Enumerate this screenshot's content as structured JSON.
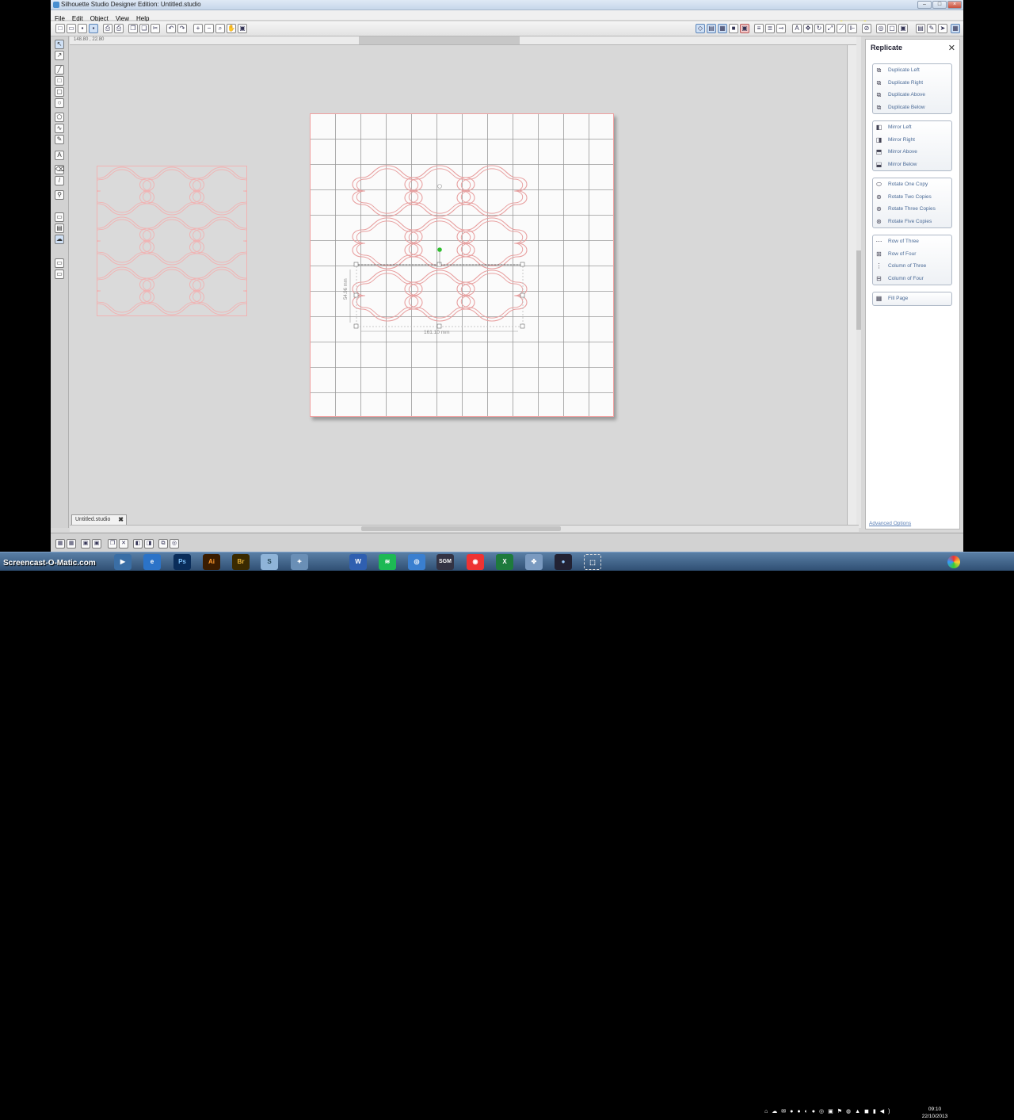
{
  "window": {
    "title": "Silhouette Studio Designer Edition: Untitled.studio"
  },
  "menu": [
    "File",
    "Edit",
    "Object",
    "View",
    "Help"
  ],
  "ruler": {
    "top_readout": "148.80 , 22.80"
  },
  "document_tab": {
    "label": "Untitled.studio"
  },
  "selection": {
    "width_label": "161.10 mm",
    "height_label": "54.96 mm"
  },
  "replicate_panel": {
    "title": "Replicate",
    "groups": [
      [
        "Duplicate Left",
        "Duplicate Right",
        "Duplicate Above",
        "Duplicate Below"
      ],
      [
        "Mirror Left",
        "Mirror Right",
        "Mirror Above",
        "Mirror Below"
      ],
      [
        "Rotate One Copy",
        "Rotate Two Copies",
        "Rotate Three Copies",
        "Rotate Five Copies"
      ],
      [
        "Row of Three",
        "Row of Four",
        "Column of Three",
        "Column of Four"
      ],
      [
        "Fill Page"
      ]
    ],
    "advanced": "Advanced Options"
  },
  "taskbar": {
    "apps": [
      "Ps",
      "Ai",
      "Br",
      "SGM"
    ],
    "clock_time": "09:10",
    "clock_date": "22/10/2013"
  },
  "watermark": "Screencast-O-Matic.com",
  "colors": {
    "cut_line": "#e8a0a0",
    "accent": "#4a6a96",
    "mat_grid": "#9a9a9a",
    "anchor": "#2fbf2f"
  }
}
